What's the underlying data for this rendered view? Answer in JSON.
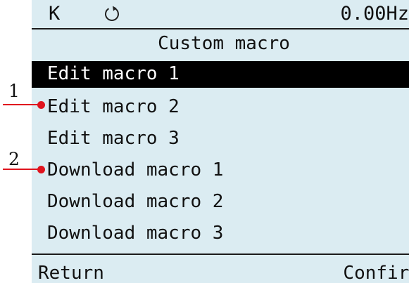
{
  "status": {
    "mode": "K",
    "rotation_icon": "rotate-icon",
    "frequency": "0.00Hz"
  },
  "title": "Custom macro",
  "menu": {
    "items": [
      {
        "label": "Edit macro 1",
        "selected": true
      },
      {
        "label": "Edit macro 2",
        "selected": false
      },
      {
        "label": "Edit macro 3",
        "selected": false
      },
      {
        "label": "Download macro 1",
        "selected": false
      },
      {
        "label": "Download macro 2",
        "selected": false
      },
      {
        "label": "Download macro 3",
        "selected": false
      }
    ]
  },
  "softkeys": {
    "left": "Return",
    "right": "Confirm"
  },
  "callouts": [
    {
      "number": "1"
    },
    {
      "number": "2"
    }
  ],
  "colors": {
    "screen_background": "#dbecf2",
    "selection_background": "#000000",
    "selection_text": "#ffffff",
    "callout_marker": "#e0141e"
  }
}
